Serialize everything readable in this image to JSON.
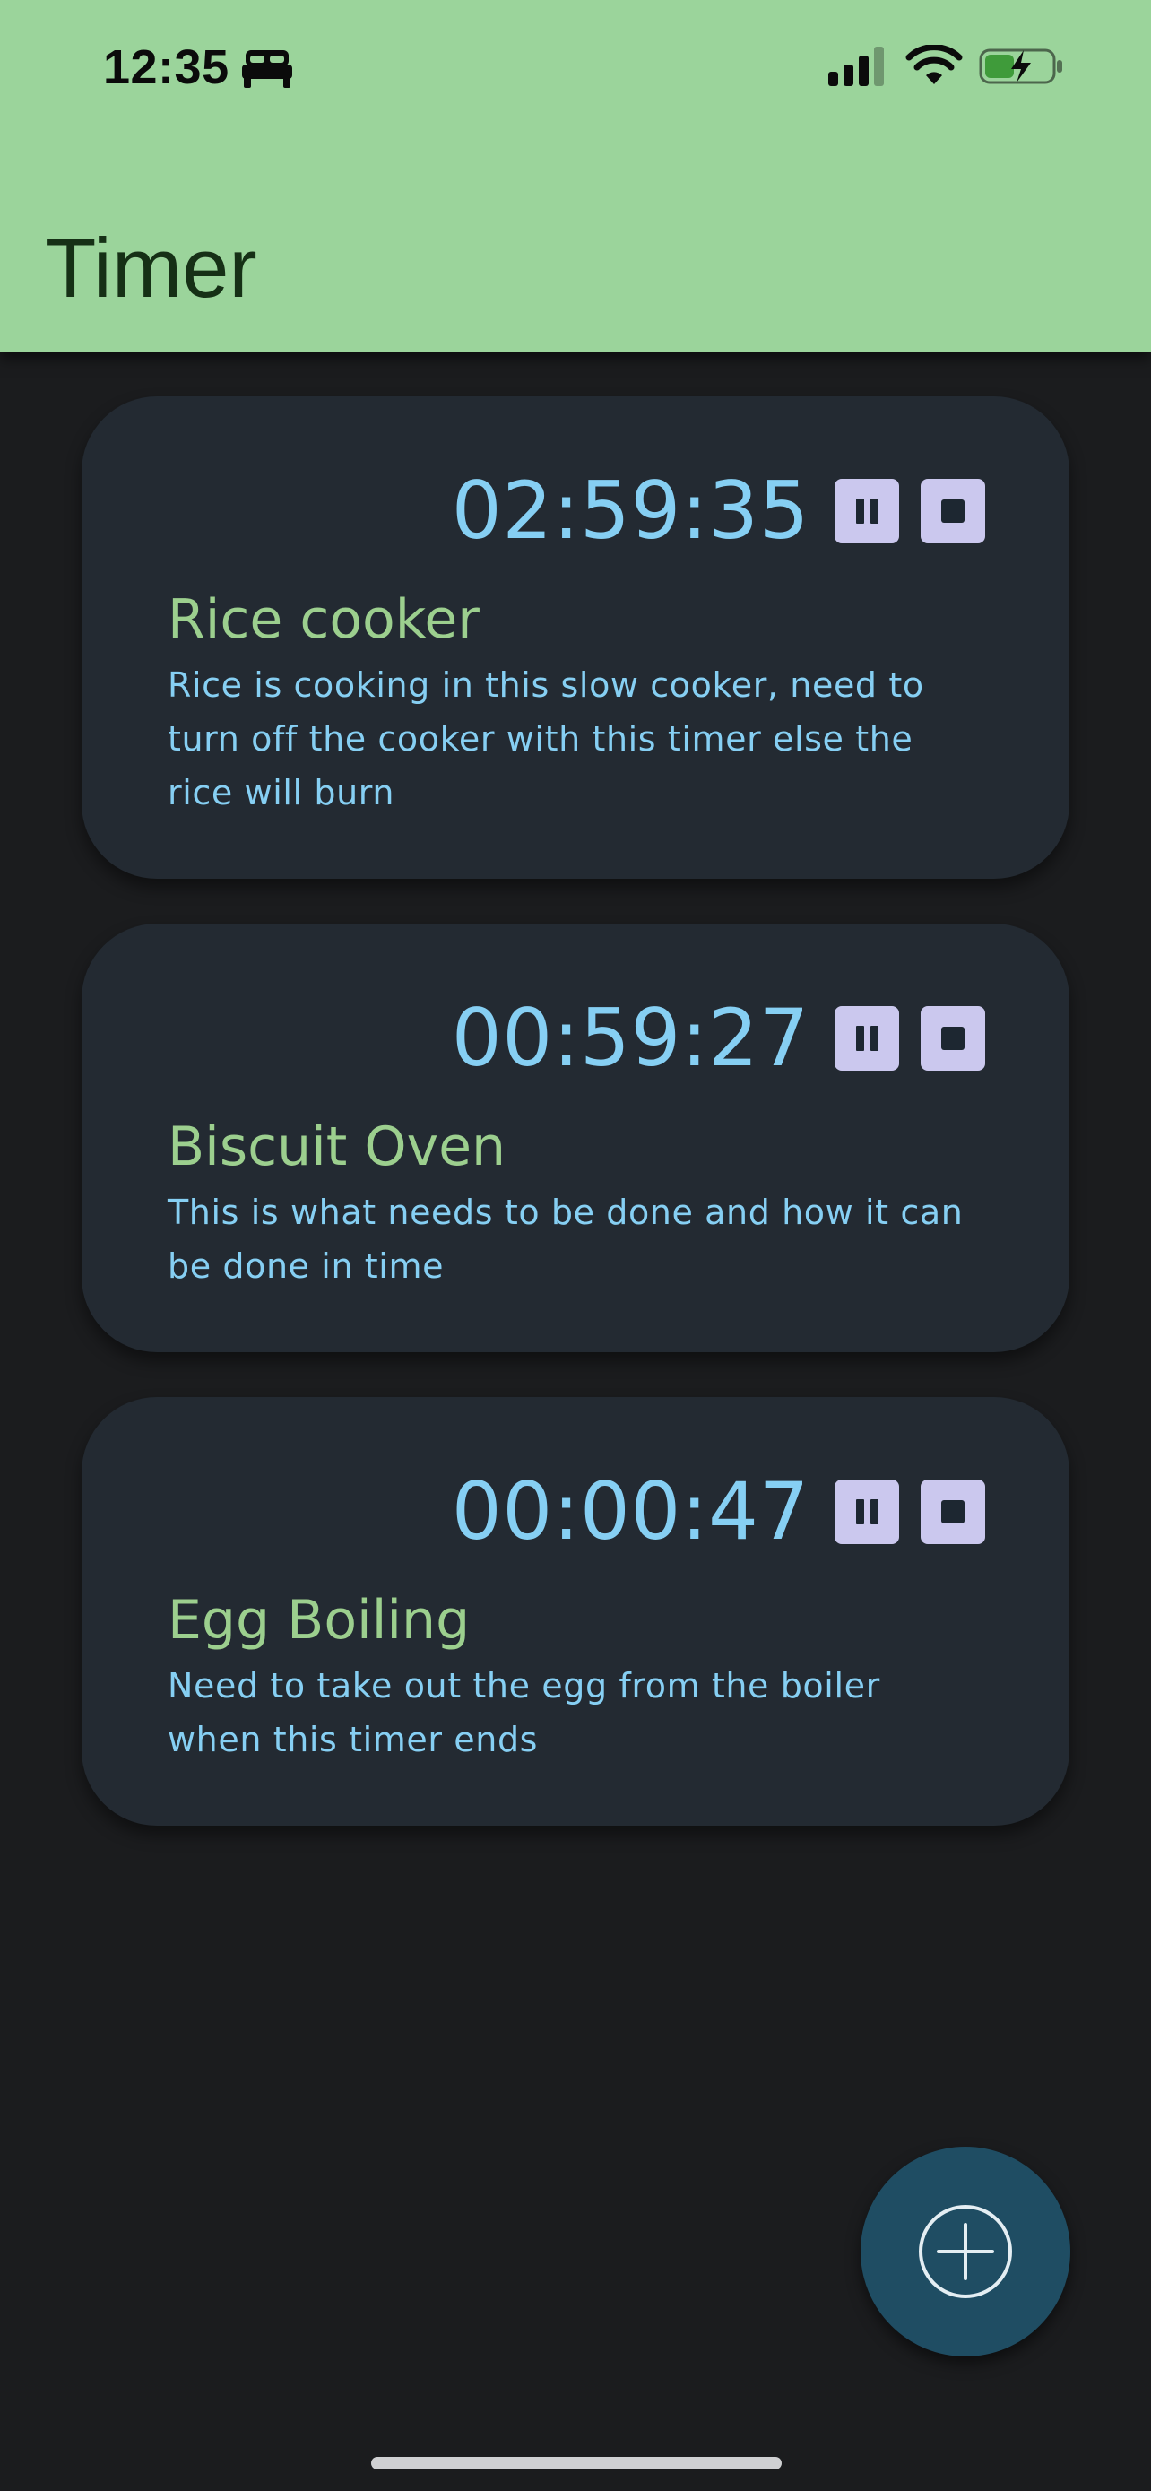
{
  "status_bar": {
    "time": "12:35",
    "focus_icon": "bed-icon",
    "signal_icon": "cellular-signal-icon",
    "wifi_icon": "wifi-icon",
    "battery_icon": "battery-charging-icon"
  },
  "app_bar": {
    "title": "Timer",
    "background": "#9bd49b",
    "title_color": "#163016"
  },
  "timers": [
    {
      "time": "02:59:35",
      "title": "Rice cooker",
      "description": "Rice is cooking in this slow cooker, need to turn off the cooker with this timer else the rice will burn",
      "pause_icon": "pause-icon",
      "stop_icon": "stop-icon"
    },
    {
      "time": "00:59:27",
      "title": "Biscuit Oven",
      "description": "This is what needs to be done and how it can be done in time",
      "pause_icon": "pause-icon",
      "stop_icon": "stop-icon"
    },
    {
      "time": "00:00:47",
      "title": "Egg Boiling",
      "description": "Need to take out the egg from the boiler when this timer ends",
      "pause_icon": "pause-icon",
      "stop_icon": "stop-icon"
    }
  ],
  "fab": {
    "icon": "add-circle-icon",
    "background": "#1f4d63"
  },
  "colors": {
    "page_background": "#1b1c1e",
    "card_background": "#232a32",
    "time_text": "#86cff3",
    "title_text": "#9ccf8e",
    "description_text": "#86cff3",
    "control_button": "#cbc8ee"
  }
}
